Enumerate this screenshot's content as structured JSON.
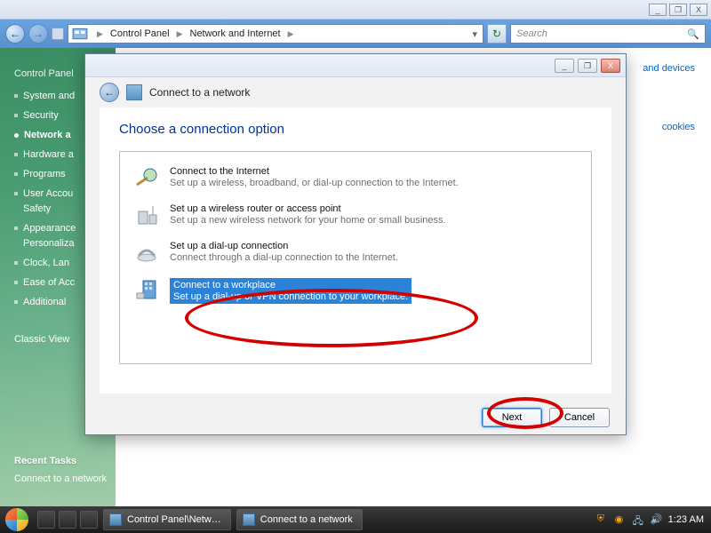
{
  "explorer": {
    "breadcrumb": {
      "root_arrow": "▸",
      "item1": "Control Panel",
      "item2": "Network and Internet"
    },
    "search_placeholder": "Search",
    "title_buttons": {
      "min": "_",
      "max": "❐",
      "close": "X"
    }
  },
  "sidebar": {
    "parent": "Control Panel",
    "items": [
      {
        "label": "System and"
      },
      {
        "label": "Security"
      },
      {
        "label": "Network a",
        "selected": true
      },
      {
        "label": "Hardware a"
      },
      {
        "label": "Programs"
      },
      {
        "label": "User Accou"
      },
      {
        "label": "Safety"
      },
      {
        "label": "Appearance"
      },
      {
        "label": "Personaliza"
      },
      {
        "label": "Clock, Lan"
      },
      {
        "label": "Ease of Acc"
      },
      {
        "label": "Additional"
      }
    ],
    "classic": "Classic View",
    "recent_tasks_head": "Recent Tasks",
    "recent_task_1": "Connect to a network"
  },
  "rightlinks": {
    "l1": "and devices",
    "l2": "cookies"
  },
  "modal": {
    "title": "Connect to a network",
    "heading": "Choose a connection option",
    "options": [
      {
        "title": "Connect to the Internet",
        "sub": "Set up a wireless, broadband, or dial-up connection to the Internet."
      },
      {
        "title": "Set up a wireless router or access point",
        "sub": "Set up a new wireless network for your home or small business."
      },
      {
        "title": "Set up a dial-up connection",
        "sub": "Connect through a dial-up connection to the Internet."
      },
      {
        "title": "Connect to a workplace",
        "sub": "Set up a dial-up or VPN connection to your workplace."
      }
    ],
    "buttons": {
      "next": "Next",
      "cancel": "Cancel"
    },
    "wnd_buttons": {
      "min": "_",
      "max": "❐",
      "close": "X"
    }
  },
  "taskbar": {
    "btn1": "Control Panel\\Netw…",
    "btn2": "Connect to a network",
    "clock": "1:23 AM"
  }
}
